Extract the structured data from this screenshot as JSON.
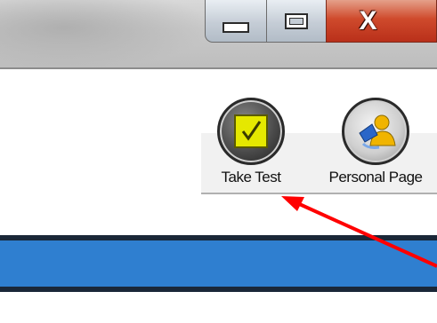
{
  "window": {
    "controls": {
      "minimize_icon": "minimize-icon",
      "maximize_icon": "maximize-icon",
      "close_label": "X"
    }
  },
  "toolbar": {
    "items": [
      {
        "label": "Take Test",
        "icon": "checkbox-icon"
      },
      {
        "label": "Personal Page",
        "icon": "person-icon"
      }
    ]
  },
  "colors": {
    "bar": "#2f7fd0",
    "arrow": "#ff0000",
    "close_button": "#cf4a2c"
  }
}
